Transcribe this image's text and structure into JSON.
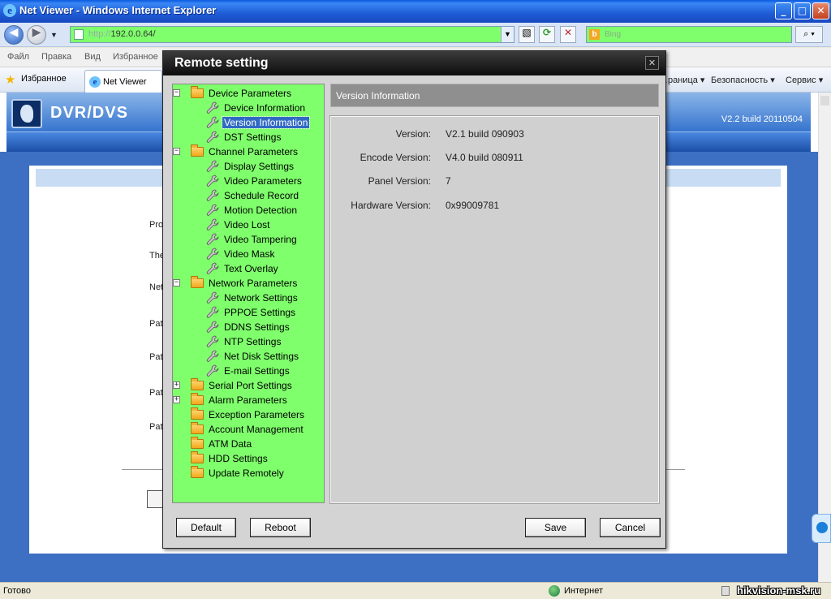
{
  "window": {
    "title": "Net Viewer - Windows Internet Explorer",
    "buttons": {
      "minimize": "_",
      "maximize": "□",
      "close": "✕"
    }
  },
  "address_bar": {
    "url_protocol": "http://",
    "url_host": "192.0.0.64/",
    "search_placeholder": "Bing"
  },
  "menu": [
    "Файл",
    "Правка",
    "Вид",
    "Избранное"
  ],
  "favorites_bar": {
    "favorites_label": "Избранное",
    "tab_label": "Net Viewer",
    "commands": [
      "…раница ▾",
      "Безопасность ▾",
      "Сервис ▾"
    ]
  },
  "page": {
    "brand": "DVR/DVS",
    "version": "V2.2  build 20110504",
    "bg_labels": [
      "Pro",
      "The",
      "Net",
      "Pat",
      "Pat",
      "Pat",
      "Pat"
    ]
  },
  "dialog": {
    "title": "Remote setting",
    "tree": [
      {
        "type": "category",
        "label": "Device Parameters",
        "expander": "−"
      },
      {
        "type": "item",
        "label": "Device Information"
      },
      {
        "type": "item",
        "label": "Version Information",
        "selected": true
      },
      {
        "type": "item",
        "label": "DST Settings"
      },
      {
        "type": "category",
        "label": "Channel Parameters",
        "expander": "−"
      },
      {
        "type": "item",
        "label": "Display Settings"
      },
      {
        "type": "item",
        "label": "Video Parameters"
      },
      {
        "type": "item",
        "label": "Schedule Record"
      },
      {
        "type": "item",
        "label": "Motion Detection"
      },
      {
        "type": "item",
        "label": "Video Lost"
      },
      {
        "type": "item",
        "label": "Video Tampering"
      },
      {
        "type": "item",
        "label": "Video Mask"
      },
      {
        "type": "item",
        "label": "Text Overlay"
      },
      {
        "type": "category",
        "label": "Network Parameters",
        "expander": "−"
      },
      {
        "type": "item",
        "label": "Network Settings"
      },
      {
        "type": "item",
        "label": "PPPOE Settings"
      },
      {
        "type": "item",
        "label": "DDNS Settings"
      },
      {
        "type": "item",
        "label": "NTP Settings"
      },
      {
        "type": "item",
        "label": "Net Disk Settings"
      },
      {
        "type": "item",
        "label": "E-mail Settings"
      },
      {
        "type": "category",
        "label": "Serial Port Settings",
        "expander": "+"
      },
      {
        "type": "category",
        "label": "Alarm Parameters",
        "expander": "+"
      },
      {
        "type": "category",
        "label": "Exception Parameters"
      },
      {
        "type": "category",
        "label": "Account Management"
      },
      {
        "type": "category",
        "label": "ATM Data"
      },
      {
        "type": "category",
        "label": "HDD Settings"
      },
      {
        "type": "category",
        "label": "Update Remotely"
      }
    ],
    "panel_title": "Version Information",
    "fields": [
      {
        "label": "Version:",
        "value": "V2.1 build 090903"
      },
      {
        "label": "Encode Version:",
        "value": "V4.0 build 080911"
      },
      {
        "label": "Panel Version:",
        "value": "7"
      },
      {
        "label": "Hardware Version:",
        "value": "0x99009781"
      }
    ],
    "buttons": {
      "default": "Default",
      "reboot": "Reboot",
      "save": "Save",
      "cancel": "Cancel"
    }
  },
  "status_bar": {
    "status": "Готово",
    "zone": "Интернет",
    "watermark": "hikvision-msk.ru"
  },
  "colors": {
    "tree_bg": "#7fff6c",
    "title_bar": "#1e5cd6",
    "dialog_title": "#1a1a1a"
  }
}
